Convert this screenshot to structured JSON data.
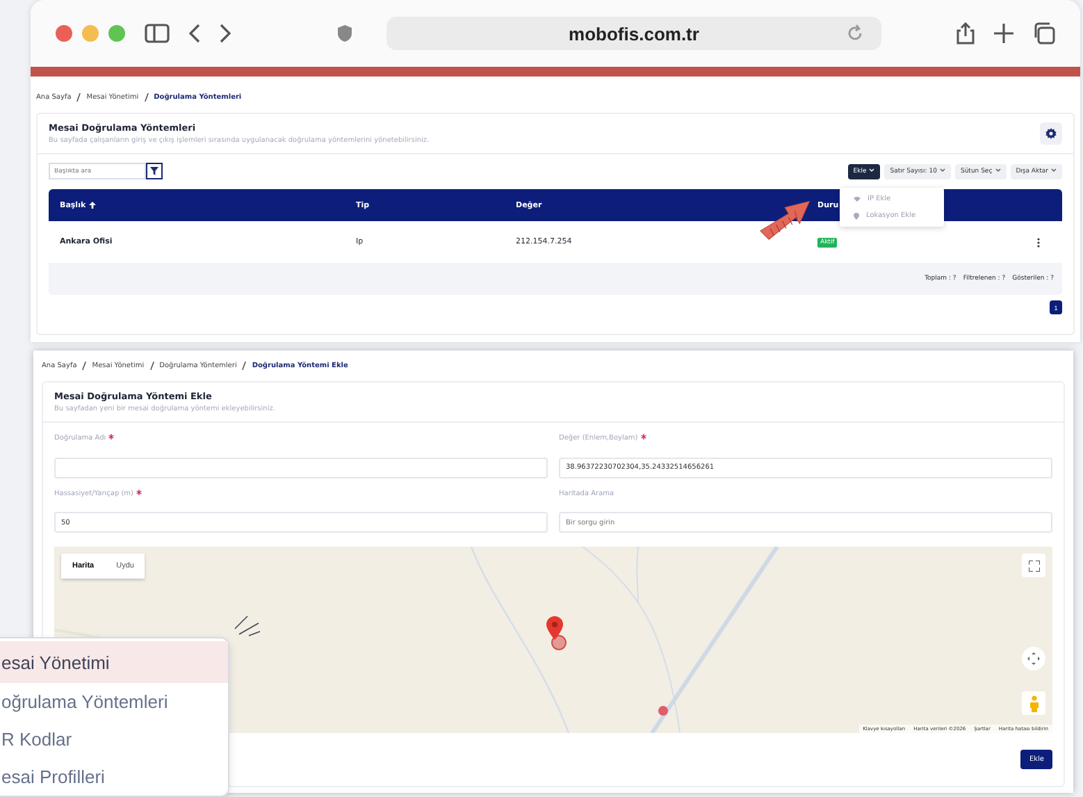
{
  "browser": {
    "url": "mobofis.com.tr"
  },
  "list_page": {
    "breadcrumb": [
      {
        "label": "Ana Sayfa",
        "current": false
      },
      {
        "label": "Mesai Yönetimi",
        "current": false
      },
      {
        "label": "Doğrulama Yöntemleri",
        "current": true
      }
    ],
    "title": "Mesai Doğrulama Yöntemleri",
    "subtitle": "Bu sayfada çalışanların giriş ve çıkış işlemleri sırasında uygulanacak doğrulama yöntemlerini yönetebilirsiniz.",
    "search": {
      "placeholder": "Başlıkta ara"
    },
    "toolbar": [
      {
        "label": "Ekle",
        "kind": "primary"
      },
      {
        "label": "Satır Sayısı: 10",
        "kind": "dropdown"
      },
      {
        "label": "Sütun Seç",
        "kind": "dropdown"
      },
      {
        "label": "Dışa Aktar",
        "kind": "dropdown"
      }
    ],
    "add_menu": [
      {
        "label": "IP Ekle",
        "kind": "ip"
      },
      {
        "label": "Lokasyon Ekle",
        "kind": "location"
      }
    ],
    "table": {
      "columns": [
        {
          "label": "Başlık",
          "sorted": true
        },
        {
          "label": "Tip",
          "sorted": false
        },
        {
          "label": "Değer",
          "sorted": false
        },
        {
          "label": "Duru"
        }
      ],
      "rows": [
        {
          "cells": [
            "Ankara Ofisi",
            "Ip",
            "212.154.7.254"
          ],
          "status": "Aktif"
        }
      ],
      "footer": [
        "Toplam : ?",
        "Filtrelenen : ?",
        "Gösterilen : ?"
      ]
    },
    "pages": [
      {
        "label": "1",
        "selected": true
      }
    ]
  },
  "form_page": {
    "breadcrumb": [
      {
        "label": "Ana Sayfa",
        "current": false
      },
      {
        "label": "Mesai Yönetimi",
        "current": false
      },
      {
        "label": "Doğrulama Yöntemleri",
        "current": false
      },
      {
        "label": "Doğrulama Yöntemi Ekle",
        "current": true
      }
    ],
    "title": "Mesai Doğrulama Yöntemi Ekle",
    "subtitle": "Bu sayfadan yeni bir mesai doğrulama yöntemi ekleyebilirsiniz.",
    "fields": [
      {
        "label": "Doğrulama Adı",
        "required": true
      },
      {
        "label": "Değer (Enlem,Boylam)",
        "required": true,
        "value": "38.96372230702304,35.24332514656261"
      },
      {
        "label": "Hassasiyet/Yarıçap (m)",
        "required": true,
        "value": "50"
      },
      {
        "label": "Haritada Arama",
        "required": false,
        "placeholder": "Bir sorgu girin"
      }
    ],
    "map": {
      "types": [
        {
          "label": "Harita",
          "selected": true
        },
        {
          "label": "Uydu",
          "selected": false
        }
      ],
      "attribution": [
        "Klavye kısayolları",
        "Harita verileri ©2026",
        "Şartlar",
        "Harita hatası bildirin"
      ]
    },
    "submit": "Ekle"
  },
  "sidebar": {
    "items": [
      {
        "label": "esai Yönetimi",
        "selected": true
      },
      {
        "label": "oğrulama Yöntemleri",
        "selected": false
      },
      {
        "label": "R Kodlar",
        "selected": false
      },
      {
        "label": "esai Profilleri",
        "selected": false
      }
    ]
  }
}
